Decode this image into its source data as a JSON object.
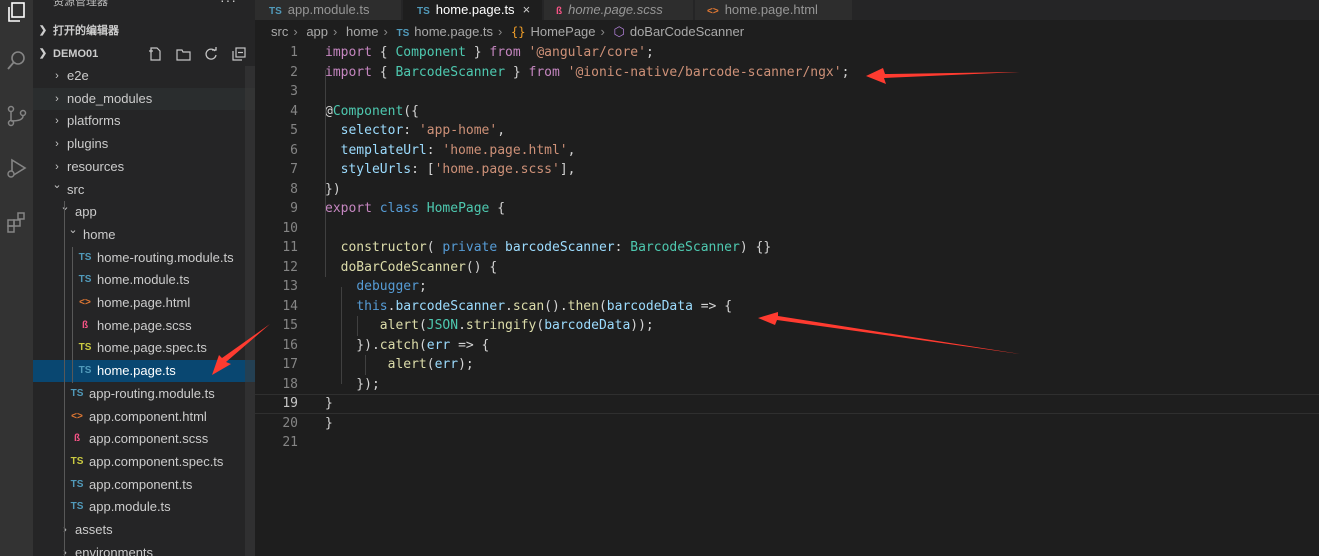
{
  "sidebar": {
    "title": "资源管理器",
    "more": "···",
    "open_editors_label": "打开的编辑器",
    "project_label": "DEMO01",
    "tree": [
      {
        "label": "e2e",
        "type": "folder",
        "open": false
      },
      {
        "label": "node_modules",
        "type": "folder",
        "open": false
      },
      {
        "label": "platforms",
        "type": "folder",
        "open": false
      },
      {
        "label": "plugins",
        "type": "folder",
        "open": false
      },
      {
        "label": "resources",
        "type": "folder",
        "open": false
      },
      {
        "label": "src",
        "type": "folder",
        "open": true
      },
      {
        "label": "app",
        "type": "folder",
        "open": true
      },
      {
        "label": "home",
        "type": "folder",
        "open": true
      },
      {
        "label": "home-routing.module.ts",
        "type": "ts"
      },
      {
        "label": "home.module.ts",
        "type": "ts"
      },
      {
        "label": "home.page.html",
        "type": "html"
      },
      {
        "label": "home.page.scss",
        "type": "scss"
      },
      {
        "label": "home.page.spec.ts",
        "type": "spec"
      },
      {
        "label": "home.page.ts",
        "type": "ts",
        "selected": true
      },
      {
        "label": "app-routing.module.ts",
        "type": "ts"
      },
      {
        "label": "app.component.html",
        "type": "html"
      },
      {
        "label": "app.component.scss",
        "type": "scss"
      },
      {
        "label": "app.component.spec.ts",
        "type": "spec"
      },
      {
        "label": "app.component.ts",
        "type": "ts"
      },
      {
        "label": "app.module.ts",
        "type": "ts"
      },
      {
        "label": "assets",
        "type": "folder",
        "open": false
      },
      {
        "label": "environments",
        "type": "folder",
        "open": false
      }
    ],
    "icon_badges": {
      "ts": "TS",
      "spec": "TS",
      "html": "<>",
      "scss": "ß"
    }
  },
  "tabs": [
    {
      "label": "app.module.ts",
      "icon": "TS",
      "italic": false,
      "active": false
    },
    {
      "label": "home.page.ts",
      "icon": "TS",
      "italic": false,
      "active": true,
      "close": "×"
    },
    {
      "label": "home.page.scss",
      "icon": "ß",
      "italic": true,
      "active": false
    },
    {
      "label": "home.page.html",
      "icon": "<>",
      "italic": false,
      "active": false
    }
  ],
  "breadcrumb": {
    "parts": [
      "src",
      "app",
      "home"
    ],
    "file_badge": "TS",
    "file": "home.page.ts",
    "class_name": "HomePage",
    "method_name": "doBarCodeScanner"
  },
  "editor": {
    "current_line": 19,
    "line_numbers": [
      "1",
      "2",
      "3",
      "4",
      "5",
      "6",
      "7",
      "8",
      "9",
      "10",
      "11",
      "12",
      "13",
      "14",
      "15",
      "16",
      "17",
      "18",
      "19",
      "20",
      "21"
    ],
    "code_lines": [
      "import { Component } from '@angular/core';",
      "import { BarcodeScanner } from '@ionic-native/barcode-scanner/ngx';",
      "",
      "@Component({",
      "  selector: 'app-home',",
      "  templateUrl: 'home.page.html',",
      "  styleUrls: ['home.page.scss'],",
      "})",
      "export class HomePage {",
      "",
      "  constructor( private barcodeScanner: BarcodeScanner) {}",
      "  doBarCodeScanner() {",
      "    debugger;",
      "    this.barcodeScanner.scan().then(barcodeData => {",
      "       alert(JSON.stringify(barcodeData));",
      "    }).catch(err => {",
      "        alert(err);",
      "    });",
      "}",
      "}",
      ""
    ]
  },
  "annotation_color": "#ff3b30"
}
